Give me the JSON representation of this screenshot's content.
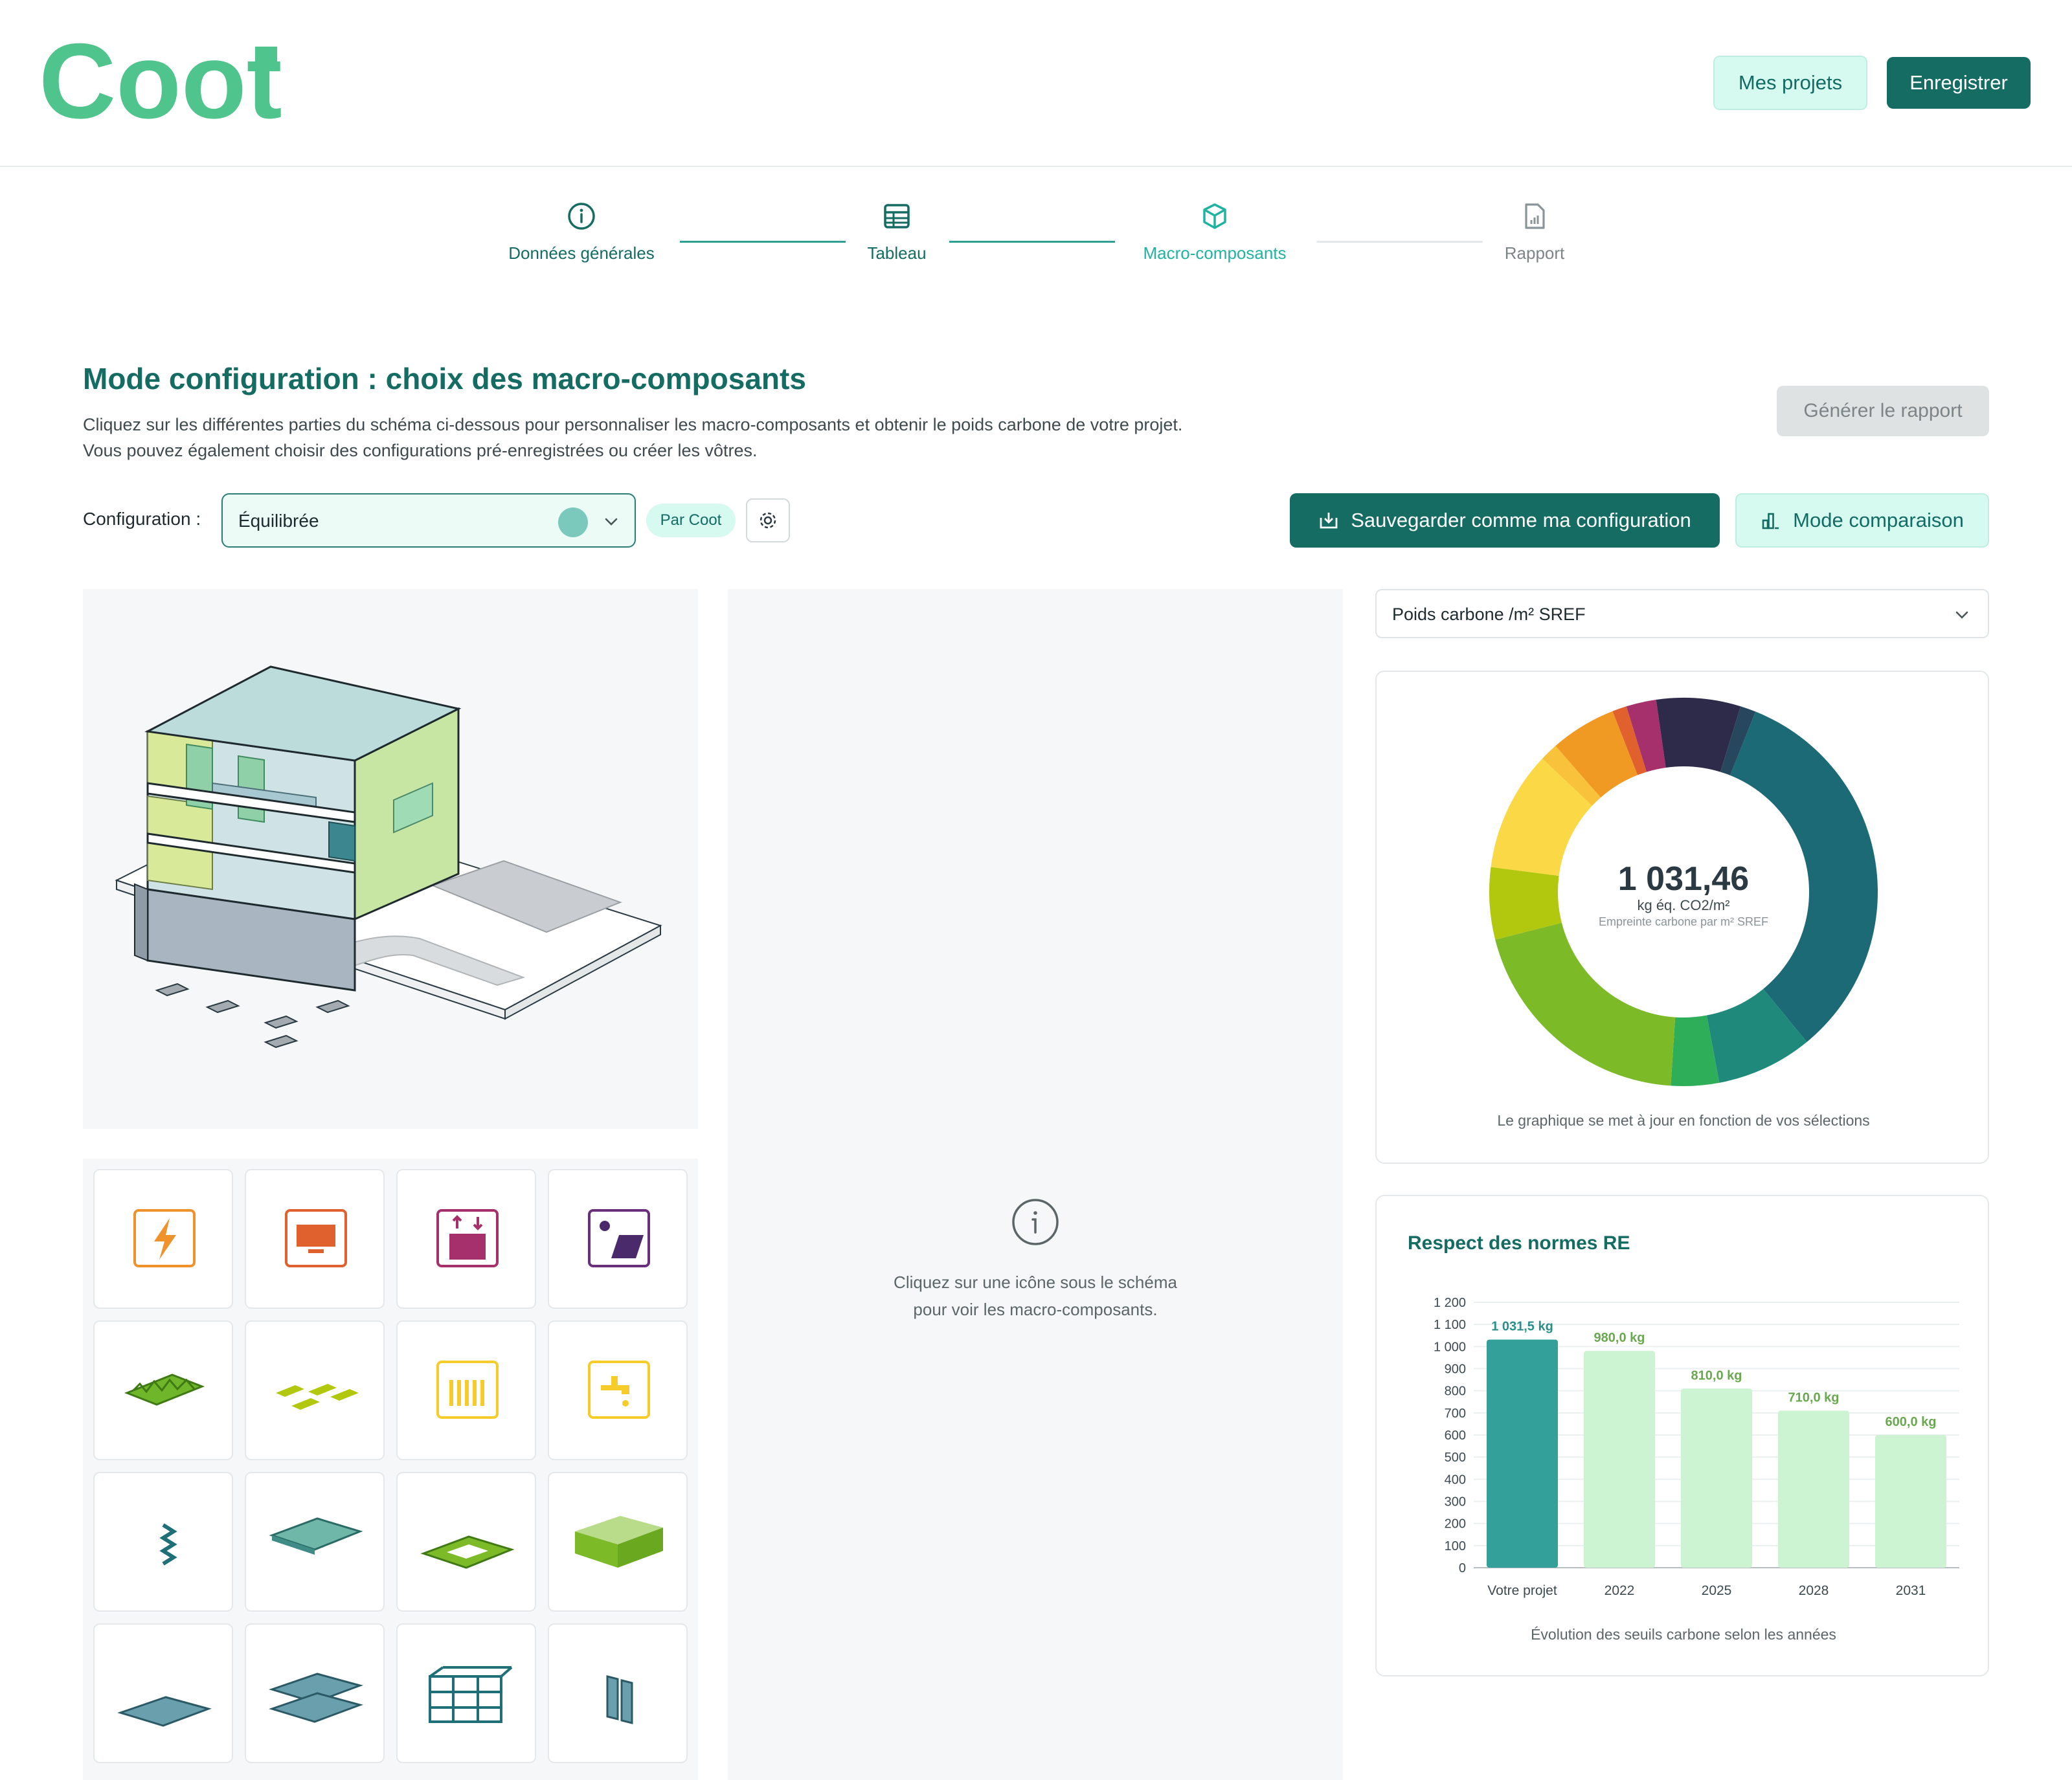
{
  "header": {
    "logo_text": "Coot",
    "projects_button": "Mes projets",
    "save_button": "Enregistrer"
  },
  "stepper": {
    "steps": [
      {
        "label": "Données générales",
        "icon": "info-icon",
        "state": "done"
      },
      {
        "label": "Tableau",
        "icon": "table-icon",
        "state": "done"
      },
      {
        "label": "Macro-composants",
        "icon": "cube-icon",
        "state": "active"
      },
      {
        "label": "Rapport",
        "icon": "report-icon",
        "state": "pending"
      }
    ]
  },
  "page": {
    "title": "Mode configuration : choix des macro-composants",
    "description_1": "Cliquez sur les différentes parties du schéma ci-dessous pour personnaliser les macro-composants et obtenir le poids carbone de votre projet.",
    "description_2": "Vous pouvez également choisir des configurations pré-enregistrées ou créer les vôtres.",
    "generate_report": "Générer le rapport"
  },
  "config": {
    "label": "Configuration :",
    "selected": "Équilibrée",
    "chip": "Par Coot",
    "save_config": "Sauvegarder comme ma configuration",
    "compare_mode": "Mode comparaison"
  },
  "tiles": [
    "electricity-icon",
    "screen-icon",
    "elevator-icon",
    "solar-panel-icon",
    "green-roof-icon",
    "exterior-fittings-icon",
    "heating-icon",
    "plumbing-icon",
    "stairs-icon",
    "floor-slab-icon",
    "foundation-ring-icon",
    "ground-volume-icon",
    "base-slab-icon",
    "intermediate-slabs-icon",
    "structure-frame-icon",
    "partition-walls-icon"
  ],
  "info": {
    "line1": "Cliquez sur une icône sous le schéma",
    "line2": "pour voir les macro-composants."
  },
  "metric_select": "Poids carbone /m² SREF",
  "donut": {
    "value": "1 031,46",
    "unit": "kg éq. CO2/m²",
    "sub": "Empreinte carbone par m² SREF",
    "caption": "Le graphique se met à jour en fonction de vos sélections"
  },
  "bar_card": {
    "title": "Respect des normes RE",
    "caption": "Évolution des seuils carbone selon les années"
  },
  "chart_data": [
    {
      "type": "pie",
      "title": "",
      "total": 1031.46,
      "segments": [
        {
          "share": 0.33,
          "color": "#1b6a76"
        },
        {
          "share": 0.08,
          "color": "#1f8a7c"
        },
        {
          "share": 0.04,
          "color": "#2fae5a"
        },
        {
          "share": 0.2,
          "color": "#7cba28"
        },
        {
          "share": 0.06,
          "color": "#b1c80f"
        },
        {
          "share": 0.1,
          "color": "#fbd845"
        },
        {
          "share": 0.015,
          "color": "#f8c23a"
        },
        {
          "share": 0.055,
          "color": "#f09a23"
        },
        {
          "share": 0.012,
          "color": "#e0602e"
        },
        {
          "share": 0.025,
          "color": "#a6306b"
        },
        {
          "share": 0.07,
          "color": "#2e2a4a"
        },
        {
          "share": 0.013,
          "color": "#27475e"
        }
      ]
    },
    {
      "type": "bar",
      "categories": [
        "Votre projet",
        "2022",
        "2025",
        "2028",
        "2031"
      ],
      "values": [
        1031.5,
        980.0,
        810.0,
        710.0,
        600.0
      ],
      "value_labels": [
        "1 031,5 kg",
        "980,0 kg",
        "810,0 kg",
        "710,0 kg",
        "600,0 kg"
      ],
      "ylim": [
        0,
        1200
      ],
      "y_ticks": [
        "0",
        "100",
        "200",
        "300",
        "400",
        "500",
        "600",
        "700",
        "800",
        "900",
        "1 000",
        "1 100",
        "1 200"
      ],
      "colors": [
        "#34a09a",
        "#ccf4d2",
        "#ccf4d2",
        "#ccf4d2",
        "#ccf4d2"
      ],
      "label_colors": [
        "#2a8f88",
        "#6aa84f",
        "#6aa84f",
        "#6aa84f",
        "#6aa84f"
      ],
      "grid": true
    }
  ]
}
